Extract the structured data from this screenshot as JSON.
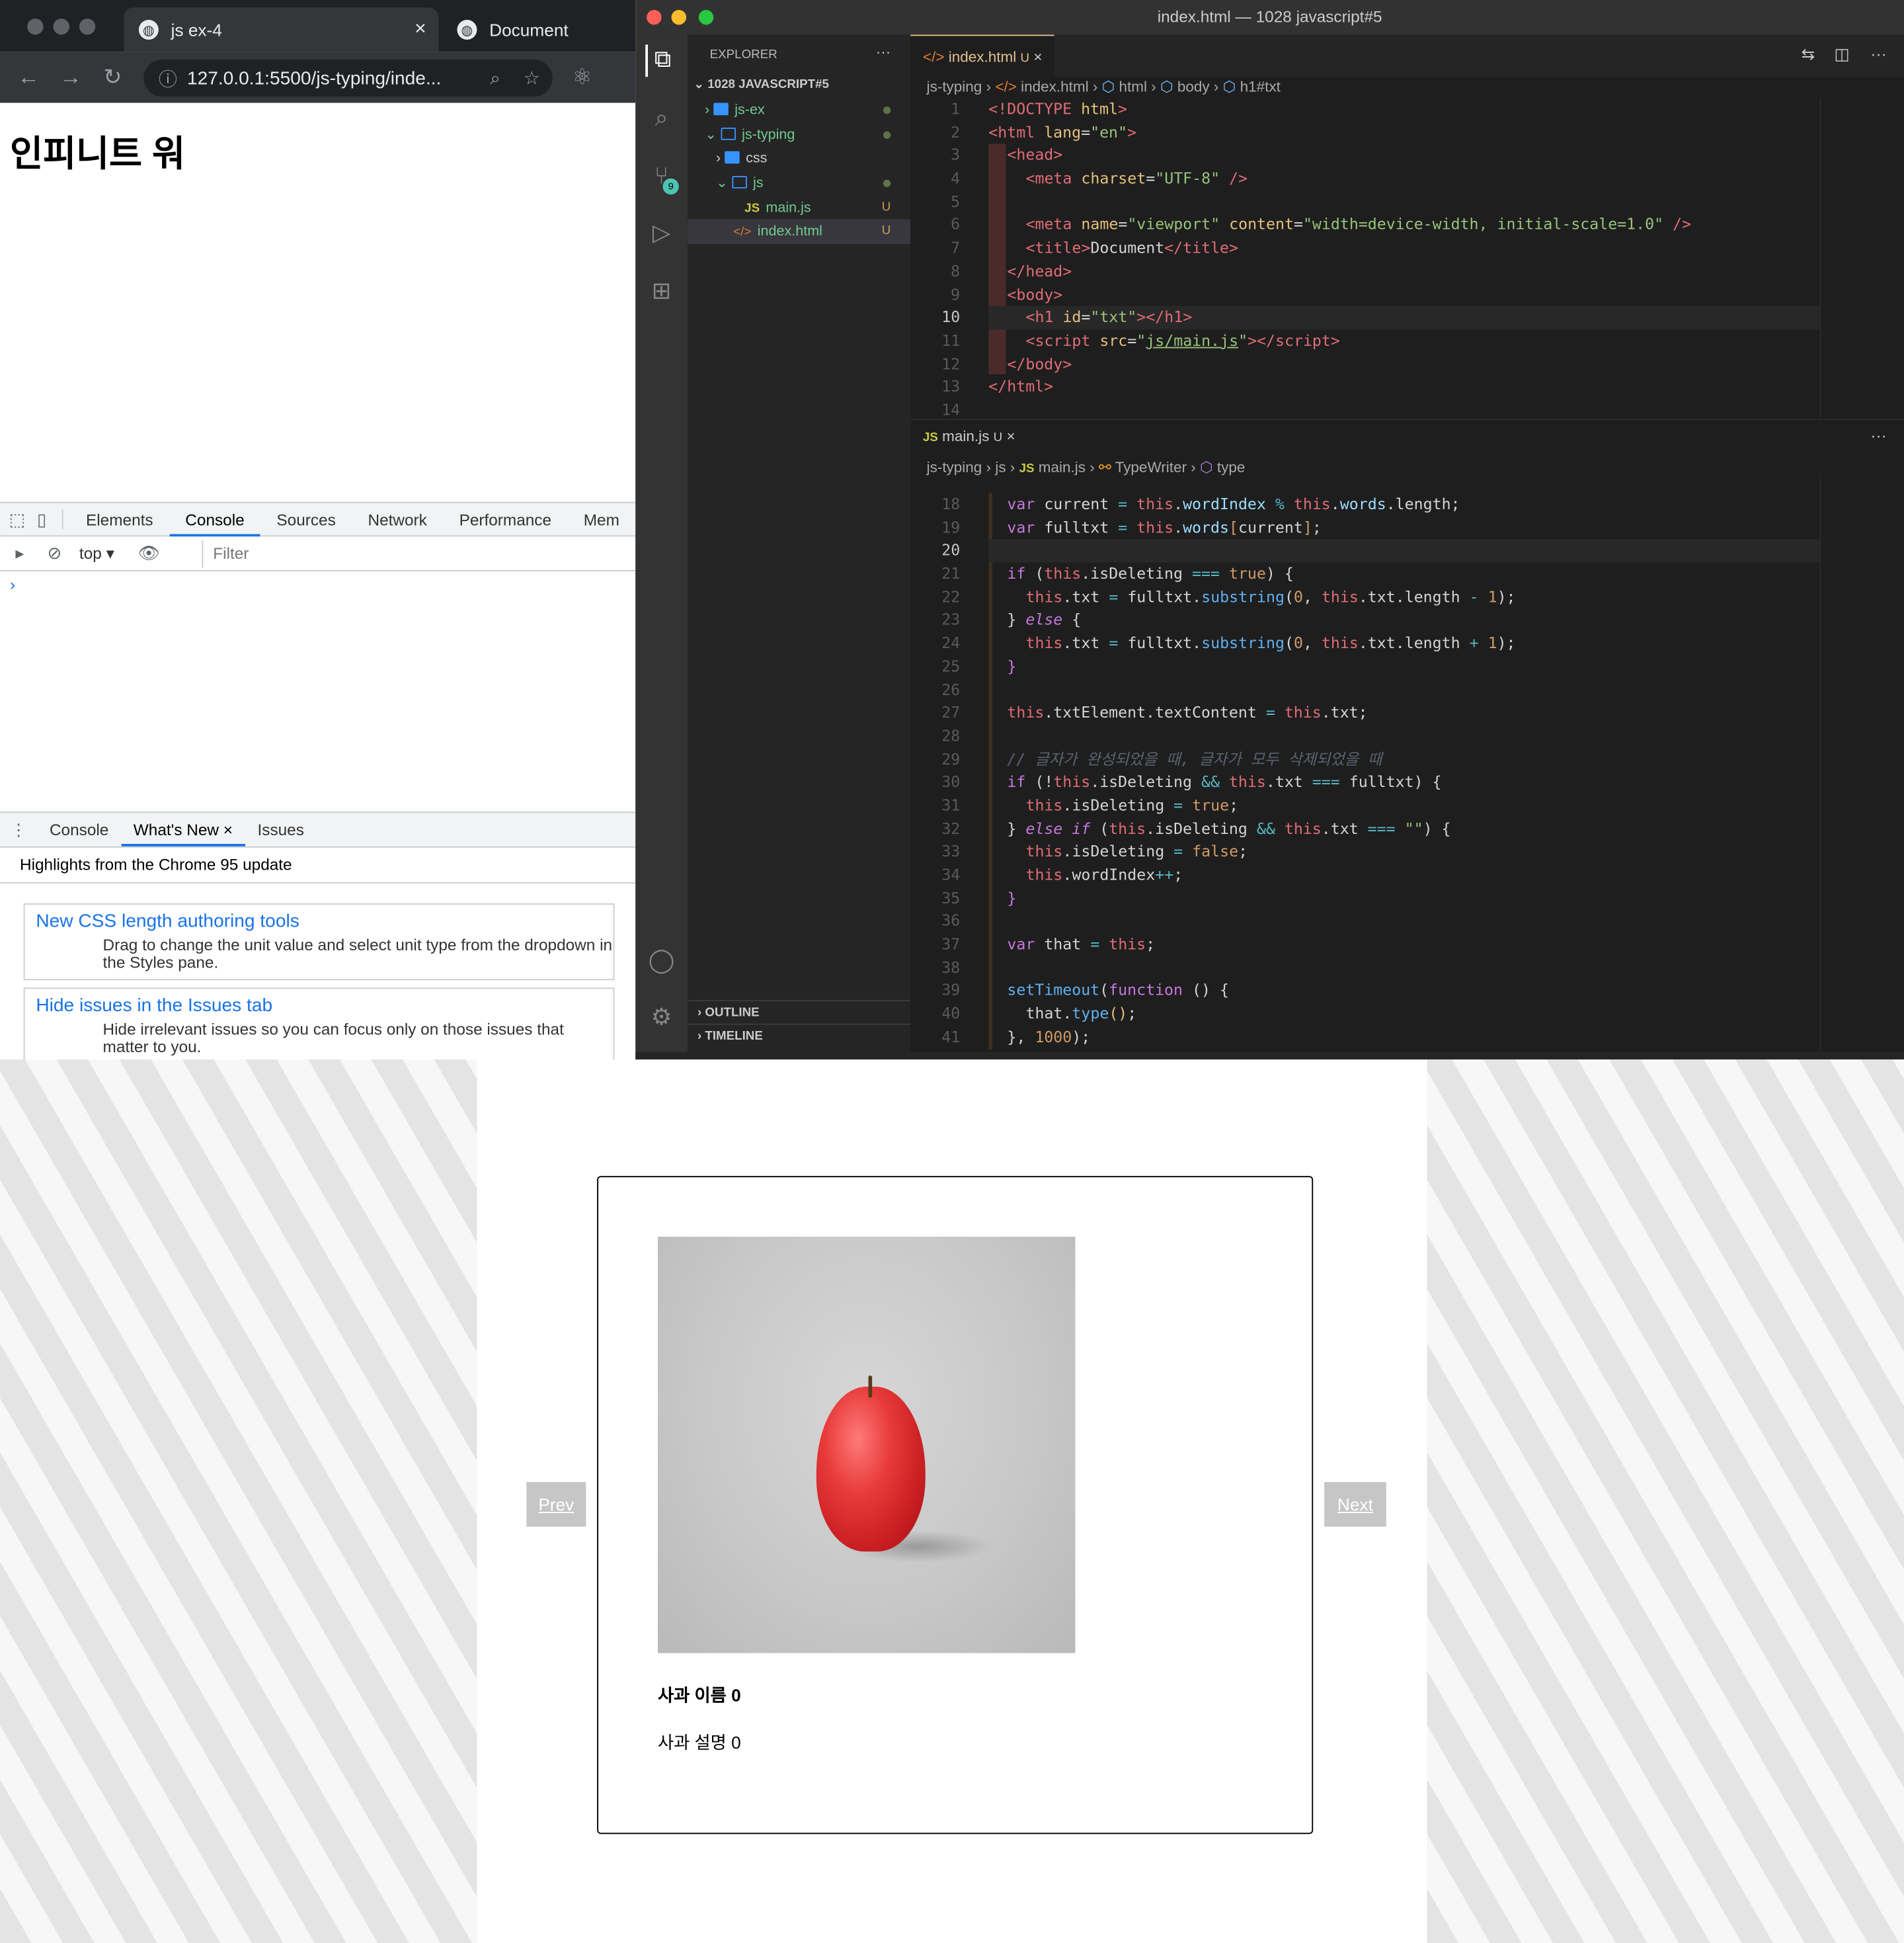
{
  "browser": {
    "tabs": [
      {
        "title": "js ex-4",
        "close": "×"
      },
      {
        "title": "Document"
      }
    ],
    "url": "127.0.0.1:5500/js-typing/inde...",
    "page_heading": "인피니트 워",
    "devtools_tabs": [
      "Elements",
      "Console",
      "Sources",
      "Network",
      "Performance",
      "Mem"
    ],
    "context": "top",
    "filter_placeholder": "Filter",
    "prompt": "›",
    "drawer_tabs": [
      "Console",
      "What's New",
      "Issues"
    ],
    "drawer_close": "×",
    "highlights": "Highlights from the Chrome 95 update",
    "cards": [
      {
        "title": "New CSS length authoring tools",
        "desc": "Drag to change the unit value and select unit type from the dropdown in the Styles pane."
      },
      {
        "title": "Hide issues in the Issues tab",
        "desc": "Hide irrelevant issues so you can focus only on those issues that matter to you."
      }
    ]
  },
  "vscode": {
    "window_title": "index.html — 1028 javascript#5",
    "explorer_label": "EXPLORER",
    "explorer_more": "···",
    "workspace": "1028 JAVASCRIPT#5",
    "tree": [
      {
        "name": "js-ex",
        "badge": ""
      },
      {
        "name": "js-typing",
        "badge": ""
      },
      {
        "name": "css",
        "badge": ""
      },
      {
        "name": "js",
        "badge": ""
      },
      {
        "name": "main.js",
        "badge": "U",
        "icon": "JS"
      },
      {
        "name": "index.html",
        "badge": "U",
        "icon": "</>"
      }
    ],
    "scm_badge": "9",
    "outline": "OUTLINE",
    "timeline": "TIMELINE",
    "tab1": {
      "name": "index.html",
      "state": "U",
      "close": "×"
    },
    "tab1_breadcrumb": [
      "js-typing",
      "index.html",
      "html",
      "body",
      "h1#txt"
    ],
    "tab2": {
      "name": "main.js",
      "state": "U",
      "close": "×"
    },
    "tab2_breadcrumb": [
      "js-typing",
      "js",
      "main.js",
      "TypeWriter",
      "type"
    ],
    "html_lines": [
      "1",
      "2",
      "3",
      "4",
      "5",
      "6",
      "7",
      "8",
      "9",
      "10",
      "11",
      "12",
      "13",
      "14"
    ],
    "js_lines": [
      "18",
      "19",
      "20",
      "21",
      "22",
      "23",
      "24",
      "25",
      "26",
      "27",
      "28",
      "29",
      "30",
      "31",
      "32",
      "33",
      "34",
      "35",
      "36",
      "37",
      "38",
      "39",
      "40",
      "41"
    ],
    "comment": "// 글자가 완성되었을 때, 글자가 모두 삭제되었을 때"
  },
  "slider": {
    "prev": "Prev",
    "next": "Next",
    "name": "사과 이름 0",
    "desc": "사과 설명 0"
  }
}
